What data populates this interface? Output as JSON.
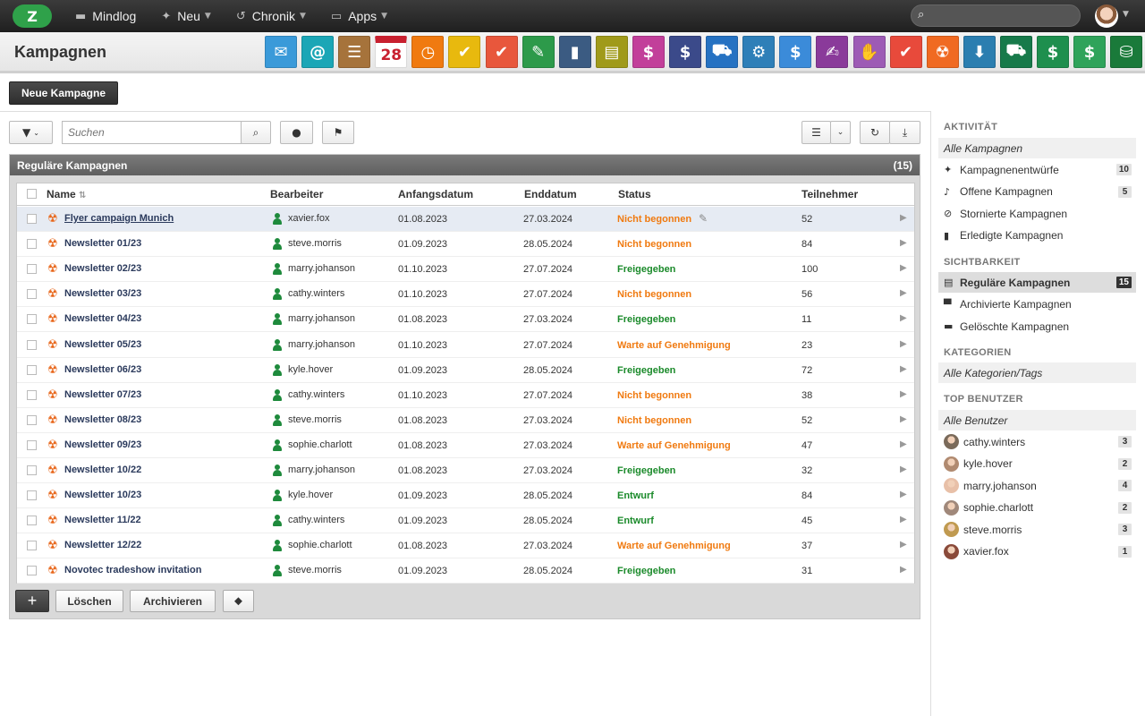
{
  "topbar": {
    "logo": "Z",
    "nav": [
      {
        "label": "Mindlog",
        "icon": "monitor-icon",
        "glyph": "▬",
        "chevron": false
      },
      {
        "label": "Neu",
        "icon": "sparkle-icon",
        "glyph": "✦",
        "chevron": true
      },
      {
        "label": "Chronik",
        "icon": "history-icon",
        "glyph": "↺",
        "chevron": true
      },
      {
        "label": "Apps",
        "icon": "tablet-icon",
        "glyph": "▭",
        "chevron": true
      }
    ],
    "search_value": ""
  },
  "header": {
    "title": "Kampagnen",
    "apps": [
      {
        "name": "email-app-icon",
        "color": "#3a9ad9",
        "glyph": "✉"
      },
      {
        "name": "email-templates-app-icon",
        "color": "#1ba6b6",
        "glyph": "@"
      },
      {
        "name": "contacts-app-icon",
        "color": "#a6733b",
        "glyph": "☰"
      },
      {
        "name": "calendar-app-icon",
        "color": "#c8202f",
        "glyph": "28"
      },
      {
        "name": "timer-app-icon",
        "color": "#f07a10",
        "glyph": "◷"
      },
      {
        "name": "tasks-app-icon",
        "color": "#e8b90e",
        "glyph": "✔"
      },
      {
        "name": "projects-app-icon",
        "color": "#e8573c",
        "glyph": "✔"
      },
      {
        "name": "notes-app-icon",
        "color": "#2d9a4a",
        "glyph": "✎"
      },
      {
        "name": "bookmarks-app-icon",
        "color": "#3b5b82",
        "glyph": "▮"
      },
      {
        "name": "documents-app-icon",
        "color": "#a09a1a",
        "glyph": "▤"
      },
      {
        "name": "helpdesk-app-icon",
        "color": "#c23f9a",
        "glyph": "$"
      },
      {
        "name": "finance-app-icon",
        "color": "#3b4a8a",
        "glyph": "$"
      },
      {
        "name": "shipping-app-icon",
        "color": "#2672c2",
        "glyph": "⛟"
      },
      {
        "name": "support-app-icon",
        "color": "#2e7fb8",
        "glyph": "⚙"
      },
      {
        "name": "budget-app-icon",
        "color": "#3b8bd9",
        "glyph": "$"
      },
      {
        "name": "contracts-app-icon",
        "color": "#8a3a9a",
        "glyph": "✍"
      },
      {
        "name": "partners-app-icon",
        "color": "#9d5bb5",
        "glyph": "✋"
      },
      {
        "name": "pdf-app-icon",
        "color": "#e84a3b",
        "glyph": "✔"
      },
      {
        "name": "campaigns-app-icon",
        "color": "#f06a22",
        "glyph": "☢"
      },
      {
        "name": "download-app-icon",
        "color": "#2b7eb0",
        "glyph": "⬇"
      },
      {
        "name": "purchasing-app-icon",
        "color": "#177a4a",
        "glyph": "⛟"
      },
      {
        "name": "sales-app-icon",
        "color": "#1e8f4e",
        "glyph": "$"
      },
      {
        "name": "products-app-icon",
        "color": "#2fa35a",
        "glyph": "$"
      },
      {
        "name": "database-app-icon",
        "color": "#1a7a3a",
        "glyph": "⛁"
      }
    ]
  },
  "new_campaign_label": "Neue Kampagne",
  "toolbar": {
    "search_placeholder": "Suchen"
  },
  "panel": {
    "title": "Reguläre Kampagnen",
    "count": "(15)",
    "columns": {
      "name": "Name",
      "editor": "Bearbeiter",
      "start": "Anfangsdatum",
      "end": "Enddatum",
      "status": "Status",
      "participants": "Teilnehmer"
    },
    "rows": [
      {
        "name": "Flyer campaign Munich",
        "user": "xavier.fox",
        "start": "01.08.2023",
        "end": "27.03.2024",
        "status": "Nicht begonnen",
        "status_color": "#f07a10",
        "participants": "52",
        "selected": true
      },
      {
        "name": "Newsletter 01/23",
        "user": "steve.morris",
        "start": "01.09.2023",
        "end": "28.05.2024",
        "status": "Nicht begonnen",
        "status_color": "#f07a10",
        "participants": "84"
      },
      {
        "name": "Newsletter 02/23",
        "user": "marry.johanson",
        "start": "01.10.2023",
        "end": "27.07.2024",
        "status": "Freigegeben",
        "status_color": "#1a8a2a",
        "participants": "100"
      },
      {
        "name": "Newsletter 03/23",
        "user": "cathy.winters",
        "start": "01.10.2023",
        "end": "27.07.2024",
        "status": "Nicht begonnen",
        "status_color": "#f07a10",
        "participants": "56"
      },
      {
        "name": "Newsletter 04/23",
        "user": "marry.johanson",
        "start": "01.08.2023",
        "end": "27.03.2024",
        "status": "Freigegeben",
        "status_color": "#1a8a2a",
        "participants": "11"
      },
      {
        "name": "Newsletter 05/23",
        "user": "marry.johanson",
        "start": "01.10.2023",
        "end": "27.07.2024",
        "status": "Warte auf Genehmigung",
        "status_color": "#f07a10",
        "participants": "23"
      },
      {
        "name": "Newsletter 06/23",
        "user": "kyle.hover",
        "start": "01.09.2023",
        "end": "28.05.2024",
        "status": "Freigegeben",
        "status_color": "#1a8a2a",
        "participants": "72"
      },
      {
        "name": "Newsletter 07/23",
        "user": "cathy.winters",
        "start": "01.10.2023",
        "end": "27.07.2024",
        "status": "Nicht begonnen",
        "status_color": "#f07a10",
        "participants": "38"
      },
      {
        "name": "Newsletter 08/23",
        "user": "steve.morris",
        "start": "01.08.2023",
        "end": "27.03.2024",
        "status": "Nicht begonnen",
        "status_color": "#f07a10",
        "participants": "52"
      },
      {
        "name": "Newsletter 09/23",
        "user": "sophie.charlott",
        "start": "01.08.2023",
        "end": "27.03.2024",
        "status": "Warte auf Genehmigung",
        "status_color": "#f07a10",
        "participants": "47"
      },
      {
        "name": "Newsletter 10/22",
        "user": "marry.johanson",
        "start": "01.08.2023",
        "end": "27.03.2024",
        "status": "Freigegeben",
        "status_color": "#1a8a2a",
        "participants": "32"
      },
      {
        "name": "Newsletter 10/23",
        "user": "kyle.hover",
        "start": "01.09.2023",
        "end": "28.05.2024",
        "status": "Entwurf",
        "status_color": "#1a8a2a",
        "participants": "84"
      },
      {
        "name": "Newsletter 11/22",
        "user": "cathy.winters",
        "start": "01.09.2023",
        "end": "28.05.2024",
        "status": "Entwurf",
        "status_color": "#1a8a2a",
        "participants": "45"
      },
      {
        "name": "Newsletter 12/22",
        "user": "sophie.charlott",
        "start": "01.08.2023",
        "end": "27.03.2024",
        "status": "Warte auf Genehmigung",
        "status_color": "#f07a10",
        "participants": "37"
      },
      {
        "name": "Novotec tradeshow invitation",
        "user": "steve.morris",
        "start": "01.09.2023",
        "end": "28.05.2024",
        "status": "Freigegeben",
        "status_color": "#1a8a2a",
        "participants": "31"
      }
    ]
  },
  "bottom": {
    "add": "+",
    "delete": "Löschen",
    "archive": "Archivieren"
  },
  "sidebar": {
    "activity_head": "AKTIVITÄT",
    "activity_all": "Alle Kampagnen",
    "activity": [
      {
        "label": "Kampagnenentwürfe",
        "icon": "sparkle-icon",
        "glyph": "✦",
        "count": "10"
      },
      {
        "label": "Offene Kampagnen",
        "icon": "bell-icon",
        "glyph": "♪",
        "count": "5"
      },
      {
        "label": "Stornierte Kampagnen",
        "icon": "ban-icon",
        "glyph": "⊘",
        "count": ""
      },
      {
        "label": "Erledigte Kampagnen",
        "icon": "book-icon",
        "glyph": "▮",
        "count": ""
      }
    ],
    "visibility_head": "SICHTBARKEIT",
    "visibility": [
      {
        "label": "Reguläre Kampagnen",
        "icon": "inbox-icon",
        "glyph": "▤",
        "count": "15",
        "active": true
      },
      {
        "label": "Archivierte Kampagnen",
        "icon": "archive-icon",
        "glyph": "▀",
        "count": ""
      },
      {
        "label": "Gelöschte Kampagnen",
        "icon": "trash-icon",
        "glyph": "▬",
        "count": ""
      }
    ],
    "categories_head": "KATEGORIEN",
    "categories_all": "Alle Kategorien/Tags",
    "users_head": "TOP BENUTZER",
    "users_all": "Alle Benutzer",
    "users": [
      {
        "label": "cathy.winters",
        "count": "3",
        "color": "#7a6a5a"
      },
      {
        "label": "kyle.hover",
        "count": "2",
        "color": "#b08a70"
      },
      {
        "label": "marry.johanson",
        "count": "4",
        "color": "#e8c0a8"
      },
      {
        "label": "sophie.charlott",
        "count": "2",
        "color": "#a0887a"
      },
      {
        "label": "steve.morris",
        "count": "3",
        "color": "#c09a50"
      },
      {
        "label": "xavier.fox",
        "count": "1",
        "color": "#8a4a3a"
      }
    ]
  }
}
